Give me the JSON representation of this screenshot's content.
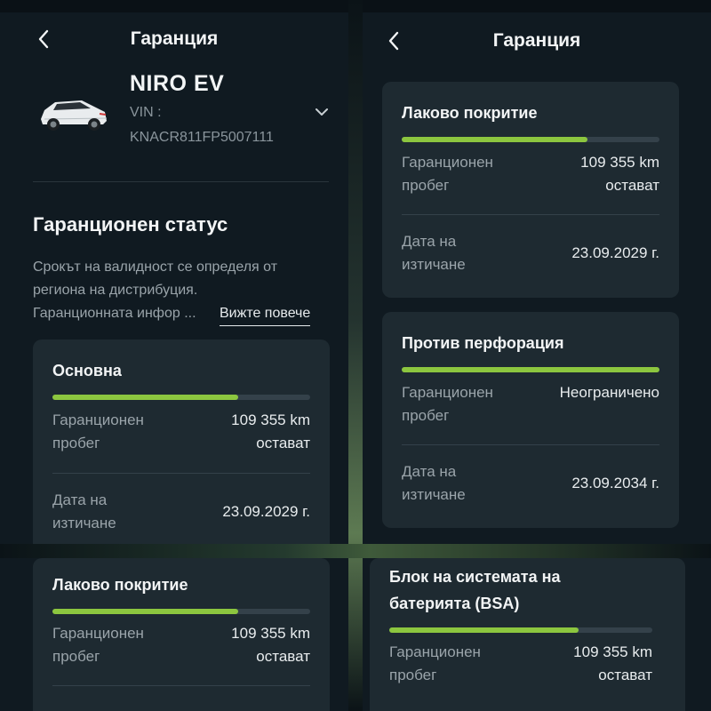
{
  "header": {
    "title": "Гаранция"
  },
  "vehicle": {
    "model": "NIRO EV",
    "vin_label": "VIN :",
    "vin": "KNACR811FP5007111"
  },
  "status": {
    "heading": "Гаранционен статус",
    "desc_line1": "Срокът на валидност се определя от",
    "desc_line2": "региона на дистрибуция.",
    "desc_line3": "Гаранционната инфор ...",
    "more": "Вижте повече"
  },
  "cards": {
    "basic": {
      "title": "Основна",
      "progress": 0.72,
      "mileage_label_1": "Гаранционен",
      "mileage_label_2": "пробег",
      "mileage_value": "109 355 km",
      "mileage_suffix": "остават",
      "date_label_1": "Дата на",
      "date_label_2": "изтичане",
      "date_value": "23.09.2029 г."
    },
    "paint": {
      "title": "Лаково покритие",
      "progress": 0.72,
      "mileage_label_1": "Гаранционен",
      "mileage_label_2": "пробег",
      "mileage_value": "109 355 km",
      "mileage_suffix": "остават",
      "date_label_1": "Дата на",
      "date_label_2": "изтичане",
      "date_value": "23.09.2029 г."
    },
    "perforation": {
      "title": "Против перфорация",
      "progress": 1.0,
      "mileage_label_1": "Гаранционен",
      "mileage_label_2": "пробег",
      "mileage_value": "Неограничено",
      "date_label_1": "Дата на",
      "date_label_2": "изтичане",
      "date_value": "23.09.2034 г."
    },
    "battery": {
      "title_1": "Блок на системата на",
      "title_2": "батерията (BSA)",
      "progress": 0.72,
      "mileage_label_1": "Гаранционен",
      "mileage_label_2": "пробег",
      "mileage_value": "109 355 km",
      "mileage_suffix": "остават"
    }
  },
  "colors": {
    "accent": "#8cc63f",
    "background": "#101a21",
    "card": "#1e2a31"
  },
  "icons": {
    "back": "chevron-left-icon",
    "expand": "chevron-down-icon",
    "car": "car-image"
  }
}
